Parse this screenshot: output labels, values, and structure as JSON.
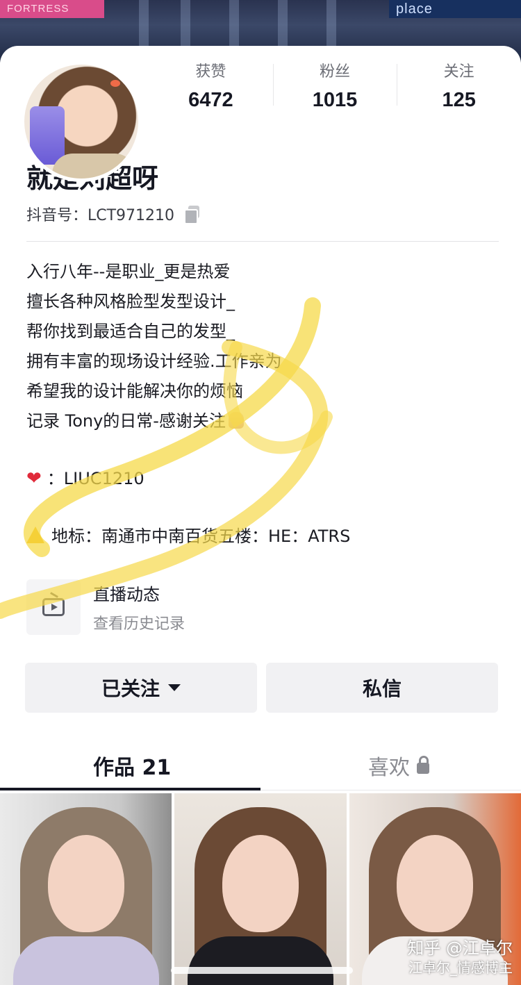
{
  "banner": {
    "sign_left": "FORTRESS",
    "sign_right": "place"
  },
  "stats": [
    {
      "label": "获赞",
      "value": "6472"
    },
    {
      "label": "粉丝",
      "value": "1015"
    },
    {
      "label": "关注",
      "value": "125"
    }
  ],
  "profile": {
    "name": "就是刘超呀",
    "douyin_id": "抖音号：LCT971210"
  },
  "bio": {
    "lines": [
      "入行八年--是职业_更是热爱",
      "擅长各种风格脸型发型设计_",
      "帮你找到最适合自己的发型_",
      "拥有丰富的现场设计经验.工作亲为",
      "希望我的设计能解决你的烦恼",
      "记录 Tony的日常-感谢关注"
    ],
    "contact": "：LIUC1210",
    "location": "地标：南通市中南百货五楼：HE：ATRS"
  },
  "live": {
    "title": "直播动态",
    "subtitle": "查看历史记录"
  },
  "actions": {
    "follow_label": "已关注",
    "message_label": "私信"
  },
  "tabs": {
    "works": "作品 21",
    "likes": "喜欢"
  },
  "icons": {
    "copy": "copy-icon",
    "heart": "heart-icon",
    "warning": "warning-icon",
    "live": "tv-icon",
    "caret": "caret-down-icon",
    "lock": "lock-icon"
  },
  "watermark": {
    "line1": "知乎 @江卓尔",
    "line2": "江卓尔_情感博主"
  },
  "colors": {
    "text": "#161823",
    "muted": "#8a8b91",
    "button_bg": "#f1f1f3",
    "highlight": "#f6d94a"
  }
}
